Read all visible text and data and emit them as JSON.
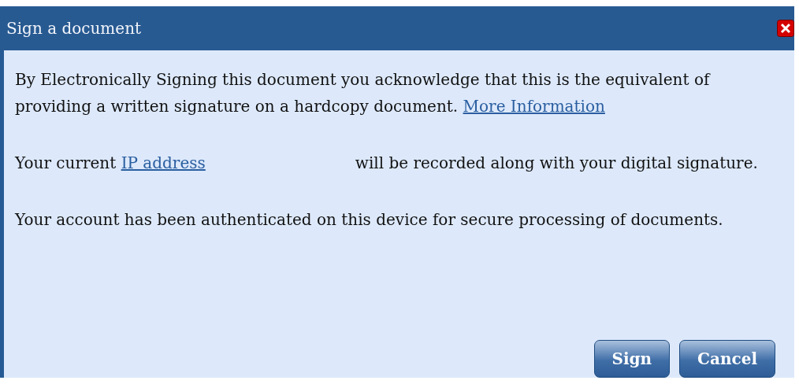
{
  "window": {
    "title": "Sign a document"
  },
  "paragraphs": [
    {
      "kind": "link-after",
      "text": "By Electronically Signing this document you acknowledge that this is the equivalent of providing a written signature on a hardcopy document.",
      "link": "More Information"
    },
    {
      "kind": "link-inside",
      "before": "Your current",
      "link": "IP address",
      "after": "will be recorded along with your digital signature."
    },
    {
      "kind": "plain",
      "text": "Your account has been authenticated on this device for secure processing of documents."
    }
  ],
  "buttons": [
    "Sign",
    "Cancel"
  ]
}
